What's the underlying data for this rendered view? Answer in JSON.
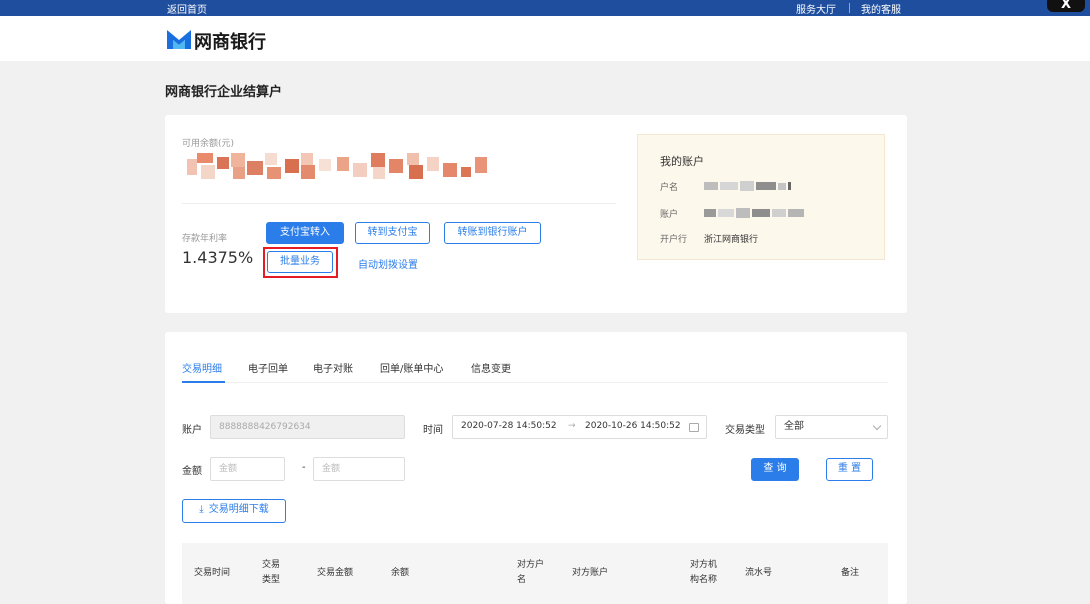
{
  "topbar": {
    "back_home": "返回首页",
    "service_hall": "服务大厅",
    "my_service": "我的客服",
    "close": "X"
  },
  "logo": {
    "text": "网商银行"
  },
  "page": {
    "title": "网商银行企业结算户"
  },
  "balance": {
    "label": "可用余额(元)"
  },
  "rate": {
    "label": "存款年利率",
    "value": "1.4375%"
  },
  "actions": {
    "alipay_in": "支付宝转入",
    "to_alipay": "转到支付宝",
    "to_bank": "转账到银行账户",
    "batch": "批量业务",
    "auto_transfer": "自动划拨设置"
  },
  "account_box": {
    "title": "我的账户",
    "name_label": "户名",
    "account_label": "账户",
    "bank_label": "开户行",
    "bank_value": "浙江网商银行"
  },
  "tabs": [
    {
      "label": "交易明细"
    },
    {
      "label": "电子回单"
    },
    {
      "label": "电子对账"
    },
    {
      "label": "回单/账单中心"
    },
    {
      "label": "信息变更"
    }
  ],
  "filters": {
    "account_label": "账户",
    "account_value": "8888888426792634",
    "time_label": "时间",
    "date_start": "2020-07-28 14:50:52",
    "date_arrow": "→",
    "date_end": "2020-10-26 14:50:52",
    "type_label": "交易类型",
    "type_value": "全部",
    "amount_label": "金额",
    "amount_placeholder": "金额",
    "dash": "-",
    "query": "查 询",
    "reset": "重 置",
    "download": "交易明细下载",
    "download_icon": "⤓"
  },
  "table": {
    "headers": [
      {
        "line1": "交易时间",
        "line2": ""
      },
      {
        "line1": "交易",
        "line2": "类型"
      },
      {
        "line1": "交易金额",
        "line2": ""
      },
      {
        "line1": "余额",
        "line2": ""
      },
      {
        "line1": "对方户",
        "line2": "名"
      },
      {
        "line1": "对方账户",
        "line2": ""
      },
      {
        "line1": "对方机",
        "line2": "构名称"
      },
      {
        "line1": "流水号",
        "line2": ""
      },
      {
        "line1": "备注",
        "line2": ""
      }
    ]
  },
  "colors": {
    "topbar": "#1f4e9e",
    "accent": "#2b7de9",
    "highlight": "#e51c23",
    "account_box_bg": "#fdf8ec"
  }
}
